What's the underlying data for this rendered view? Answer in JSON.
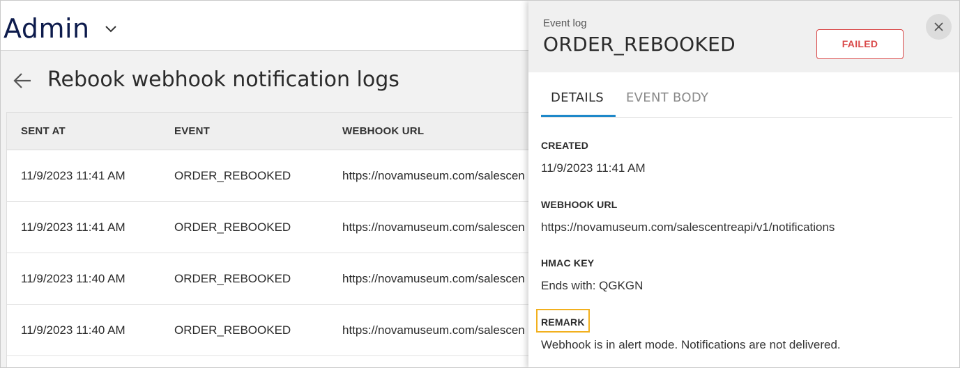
{
  "app": {
    "title": "Admin",
    "menu_icon": "chevron-down-icon"
  },
  "page": {
    "back_icon": "arrow-left-icon",
    "title": "Rebook webhook notification logs"
  },
  "table": {
    "columns": [
      "SENT AT",
      "EVENT",
      "WEBHOOK URL"
    ],
    "rows": [
      {
        "sent_at": "11/9/2023 11:41 AM",
        "event": "ORDER_REBOOKED",
        "url": "https://novamuseum.com/salescen"
      },
      {
        "sent_at": "11/9/2023 11:41 AM",
        "event": "ORDER_REBOOKED",
        "url": "https://novamuseum.com/salescen"
      },
      {
        "sent_at": "11/9/2023 11:40 AM",
        "event": "ORDER_REBOOKED",
        "url": "https://novamuseum.com/salescen"
      },
      {
        "sent_at": "11/9/2023 11:40 AM",
        "event": "ORDER_REBOOKED",
        "url": "https://novamuseum.com/salescen"
      }
    ]
  },
  "drawer": {
    "subtitle": "Event log",
    "title": "ORDER_REBOOKED",
    "status": "FAILED",
    "status_color": "#d94848",
    "close_icon": "close-icon",
    "tabs": [
      {
        "label": "DETAILS",
        "active": true
      },
      {
        "label": "EVENT BODY",
        "active": false
      }
    ],
    "accent_color": "#1e88c9",
    "highlight_color": "#f2b01e",
    "fields": {
      "created": {
        "label": "CREATED",
        "value": "11/9/2023 11:41 AM"
      },
      "webhook_url": {
        "label": "WEBHOOK URL",
        "value": "https://novamuseum.com/salescentreapi/v1/notifications"
      },
      "hmac_key": {
        "label": "HMAC KEY",
        "value": "Ends with: QGKGN"
      },
      "remark": {
        "label": "REMARK",
        "value": "Webhook is in alert mode. Notifications are not delivered."
      }
    }
  }
}
